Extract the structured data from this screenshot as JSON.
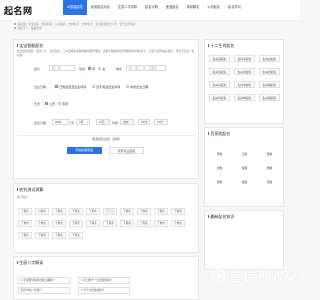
{
  "logo": "起名网",
  "nav": [
    "AI智能起名",
    "免费起名测名",
    "生辰八字测算",
    "起名字典",
    "宝宝起名",
    "周易解名",
    "公司起名",
    "起名学问"
  ],
  "intro": {
    "line1": "起名网，宝宝起名、周易起名，公司起名、吉祥名字、吉祥名字、宝宝起名结合八字、结合五行等等",
    "line2": "起名于人，福运天成"
  },
  "form": {
    "title": "宝宝智能起名",
    "note": "结合出生日期、生辰八字、五行喜用、三才五格等多种传统命理学理论，运用大数据算法智能精选吉祥好名字，让名字蕴含美好寓意，为宝宝带来一生好运。",
    "surname_label": "姓氏",
    "surname_placeholder": "如：李",
    "gender_label": "性别",
    "gender_options": [
      "男",
      "女"
    ],
    "gender_selected": "男",
    "double_label": "单双",
    "double_placeholder": "如：张三，刘、王霸道",
    "birth_status_label": "出生日期",
    "birth_status_options": [
      "已知道宝宝出生时间",
      "还不知道出生时间",
      "未定出生日期"
    ],
    "birth_status_selected": "已知道宝宝出生时间",
    "calendar_label": "历法",
    "calendar_options": [
      "公历",
      "农历"
    ],
    "calendar_selected": "公历",
    "time_label": "出生日期",
    "year": "2024",
    "year_unit": "年",
    "month": "7月",
    "day": "11日",
    "hour": "时辰",
    "hour_unit": "出时",
    "minute": "13分",
    "minute_unit": "27分",
    "more": "更多起名设置（选填）",
    "submit": "开始测算起名",
    "alt": "专家专业起名"
  },
  "sidebar": {
    "zodiac_title": "十二生肖起名",
    "zodiac": [
      "生肖鼠起名",
      "生肖牛起名",
      "生肖虎起名",
      "生肖兔起名",
      "生肖龙起名",
      "生肖蛇起名",
      "生肖马起名",
      "生肖羊起名",
      "生肖猴起名",
      "生肖鸡起名",
      "生肖狗起名",
      "生肖猪起名"
    ],
    "hot_title": "百家姓起名",
    "hot": [
      "李姓",
      "王姓",
      "张姓",
      "刘姓",
      "陈姓",
      "杨姓",
      "黄姓",
      "赵姓",
      "吴姓"
    ],
    "recent_title": "最新起名知识"
  },
  "surname": {
    "title": "姓名测试测算",
    "note": "热门姓氏",
    "names": [
      "丁姓名",
      "万姓名",
      "丁姓名",
      "丁姓名",
      "丁姓名",
      "丁王二",
      "丁姓名",
      "丁姓名",
      "丁姓名",
      "丁姓名",
      "丁姓名",
      "丁姓名",
      "丁姓名",
      "丁姓名",
      "丁姓名",
      "丁姓名",
      "丁姓名",
      "丁姓名",
      "丁姓名",
      "丁姓名",
      "丁姓名",
      "丁姓名",
      "丁姓名",
      "丁姓名"
    ]
  },
  "bazi": {
    "title": "生辰八字解读",
    "links": [
      "八字命理分析的出生日期简介",
      "八字日柱十一日出生的简介",
      "四字中的八字简介",
      "八字十日出生的简介"
    ]
  },
  "watermark": "星链秒收录"
}
